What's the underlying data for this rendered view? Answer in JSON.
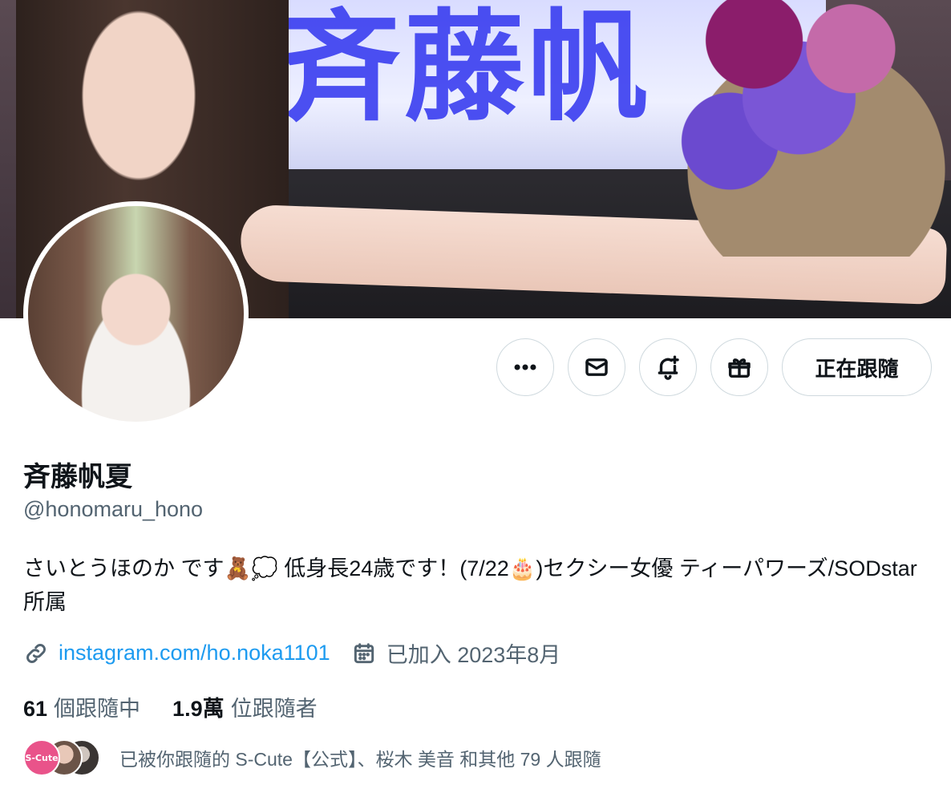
{
  "banner": {
    "screen_text": "斉藤帆"
  },
  "profile": {
    "name": "斉藤帆夏",
    "handle": "@honomaru_hono",
    "bio": "さいとうほのか です🧸💭 低身長24歳です！(7/22🎂)セクシー女優 ティーパワーズ/SODstar所属",
    "link": "instagram.com/ho.noka1101",
    "joined": "已加入 2023年8月"
  },
  "actions": {
    "more_icon": "more-horizontal-icon",
    "message_icon": "envelope-icon",
    "notify_icon": "bell-plus-icon",
    "gift_icon": "gift-icon",
    "follow_label": "正在跟隨"
  },
  "stats": {
    "following_count": "61",
    "following_label": "個跟隨中",
    "followers_count": "1.9萬",
    "followers_label": "位跟隨者"
  },
  "followed_by": {
    "avatar1_text": "S-Cute",
    "text": "已被你跟隨的 S-Cute【公式】、桜木 美音 和其他 79 人跟隨"
  },
  "colors": {
    "link": "#1d9bf0",
    "secondary_text": "#536471",
    "border": "#cfd9de"
  }
}
